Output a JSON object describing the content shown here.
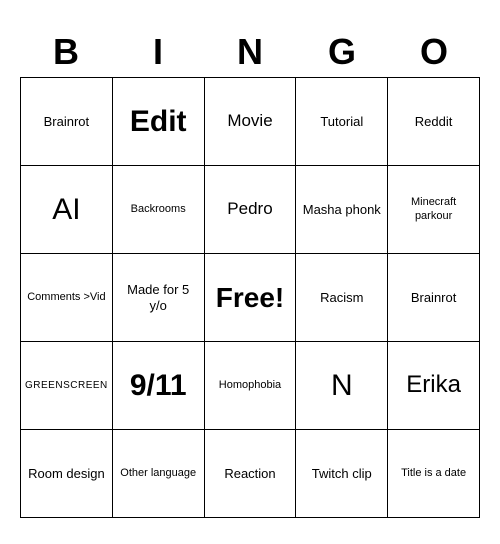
{
  "header": {
    "letters": [
      "B",
      "I",
      "N",
      "G",
      "O"
    ]
  },
  "cells": [
    {
      "text": "Brainrot",
      "size": "sm"
    },
    {
      "text": "Edit",
      "size": "xl",
      "bold": true
    },
    {
      "text": "Movie",
      "size": "md"
    },
    {
      "text": "Tutorial",
      "size": "sm"
    },
    {
      "text": "Reddit",
      "size": "sm"
    },
    {
      "text": "AI",
      "size": "xl"
    },
    {
      "text": "Backrooms",
      "size": "xs"
    },
    {
      "text": "Pedro",
      "size": "md"
    },
    {
      "text": "Masha phonk",
      "size": "sm"
    },
    {
      "text": "Minecraft parkour",
      "size": "xs"
    },
    {
      "text": "Comments >Vid",
      "size": "xs"
    },
    {
      "text": "Made for 5 y/o",
      "size": "sm"
    },
    {
      "text": "Free!",
      "size": "free"
    },
    {
      "text": "Racism",
      "size": "sm"
    },
    {
      "text": "Brainrot",
      "size": "sm"
    },
    {
      "text": "GREENSCREEN",
      "size": "xs",
      "caps": true
    },
    {
      "text": "9/11",
      "size": "xl",
      "bold": true
    },
    {
      "text": "Homophobia",
      "size": "xs"
    },
    {
      "text": "N",
      "size": "xl"
    },
    {
      "text": "Erika",
      "size": "lg"
    },
    {
      "text": "Room design",
      "size": "sm"
    },
    {
      "text": "Other language",
      "size": "xs"
    },
    {
      "text": "Reaction",
      "size": "sm"
    },
    {
      "text": "Twitch clip",
      "size": "sm"
    },
    {
      "text": "Title is a date",
      "size": "xs"
    }
  ]
}
